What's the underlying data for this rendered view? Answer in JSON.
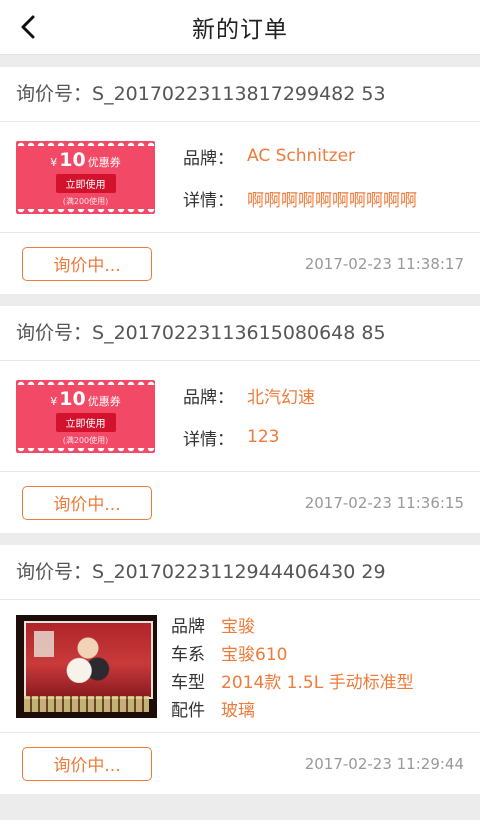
{
  "header": {
    "title": "新的订单",
    "back_icon": "chevron-left-icon"
  },
  "orders": [
    {
      "inquiry_label": "询价号：",
      "inquiry_no": "S_20170223113817299482 53",
      "image": {
        "type": "coupon",
        "amount_prefix": "¥",
        "amount": "10",
        "name": "优惠券",
        "button": "立即使用",
        "condition": "(满200使用)"
      },
      "fields": [
        {
          "label": "品牌：",
          "value": "AC Schnitzer"
        },
        {
          "label": "详情：",
          "value": "啊啊啊啊啊啊啊啊啊啊"
        }
      ],
      "status": "询价中...",
      "time": "2017-02-23 11:38:17"
    },
    {
      "inquiry_label": "询价号：",
      "inquiry_no": "S_20170223113615080648 85",
      "image": {
        "type": "coupon",
        "amount_prefix": "¥",
        "amount": "10",
        "name": "优惠券",
        "button": "立即使用",
        "condition": "(满200使用)"
      },
      "fields": [
        {
          "label": "品牌：",
          "value": "北汽幻速"
        },
        {
          "label": "详情：",
          "value": "123"
        }
      ],
      "status": "询价中...",
      "time": "2017-02-23 11:36:15"
    },
    {
      "inquiry_label": "询价号：",
      "inquiry_no": "S_20170223112944406430 29",
      "image": {
        "type": "photo"
      },
      "fields": [
        {
          "label": "品牌",
          "value": "宝骏"
        },
        {
          "label": "车系",
          "value": "宝骏610"
        },
        {
          "label": "车型",
          "value": "2014款 1.5L 手动标准型"
        },
        {
          "label": "配件",
          "value": "玻璃"
        }
      ],
      "status": "询价中...",
      "time": "2017-02-23 11:29:44"
    }
  ]
}
